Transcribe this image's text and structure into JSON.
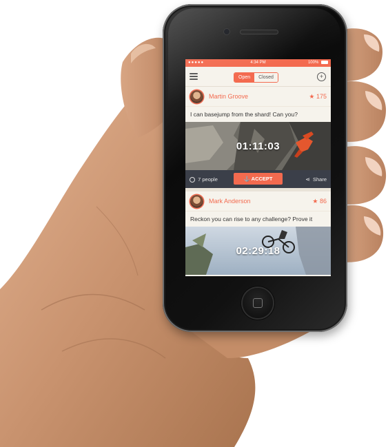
{
  "status_bar": {
    "carrier": "●●●●● ",
    "time": "4:34 PM",
    "battery": "100%"
  },
  "nav": {
    "tabs": [
      {
        "label": "Open",
        "selected": true
      },
      {
        "label": "Closed",
        "selected": false
      }
    ],
    "menu_icon": "hamburger-icon",
    "add_icon": "plus-circle-icon"
  },
  "feed": [
    {
      "user": "Martin Groove",
      "rating": "★ 175",
      "text": "I can basejump from the shard! Can you?",
      "timer": "01:11:03",
      "people": "7 people",
      "accept_label": "ACCEPT",
      "share_label": "Share"
    },
    {
      "user": "Mark Anderson",
      "rating": "★ 86",
      "text": "Reckon you can rise to any challenge? Prove it",
      "timer": "02:29:18"
    }
  ],
  "colors": {
    "accent": "#f36a4f",
    "background": "#f6f3ec",
    "action_bar": "#3b3f49"
  }
}
